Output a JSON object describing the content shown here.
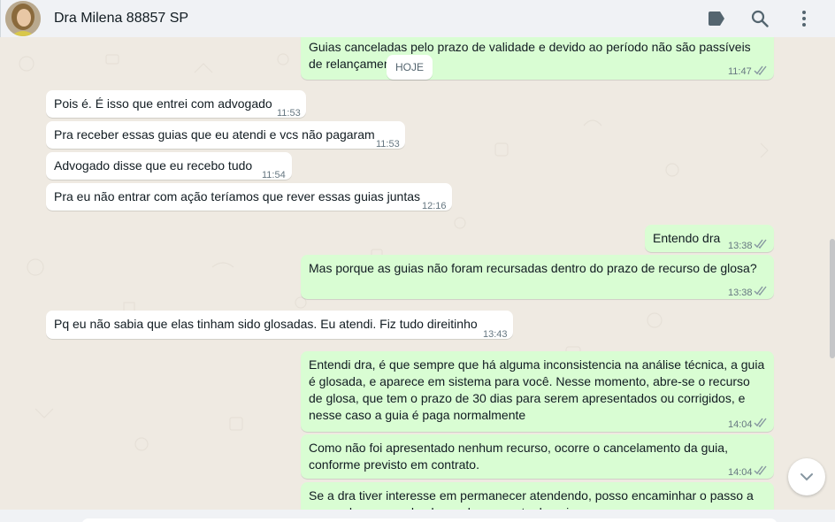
{
  "header": {
    "contact_name": "Dra Milena 88857 SP",
    "icons": [
      "label-icon",
      "search-icon",
      "menu-icon"
    ]
  },
  "chat": {
    "date_chip": "HOJE",
    "messages": [
      {
        "dir": "out",
        "text": "Guias canceladas pelo prazo de validade e devido ao período não são passíveis de relançamento.",
        "time": "11:47",
        "status": "read"
      },
      {
        "dir": "in",
        "text": "Pois é. É isso que entrei com advogado",
        "time": "11:53"
      },
      {
        "dir": "in",
        "text": "Pra receber essas guias que eu atendi e vcs não pagaram",
        "time": "11:53"
      },
      {
        "dir": "in",
        "text": "Advogado disse que eu recebo tudo",
        "time": "11:54"
      },
      {
        "dir": "in",
        "text": "Pra eu não entrar com ação teríamos que rever essas guias juntas",
        "time": "12:16"
      },
      {
        "dir": "out",
        "text": "Entendo dra",
        "time": "13:38",
        "status": "read"
      },
      {
        "dir": "out",
        "text": "Mas porque as guias não foram recursadas dentro do prazo de recurso de glosa?",
        "time": "13:38",
        "status": "read"
      },
      {
        "dir": "in",
        "text": "Pq eu não sabia que elas tinham sido glosadas. Eu atendi. Fiz tudo direitinho",
        "time": "13:43"
      },
      {
        "dir": "out",
        "text": "Entendi dra, é que sempre que há alguma inconsistencia na análise técnica, a guia é glosada, e aparece em sistema para você. Nesse momento, abre-se o recurso de glosa, que tem o prazo de 30 dias para serem apresentados ou corrigidos, e nesse caso a guia é paga normalmente",
        "time": "14:04",
        "status": "read"
      },
      {
        "dir": "out",
        "text": "Como não foi apresentado nenhum recurso, ocorre o cancelamento da guia, conforme previsto em contrato.",
        "time": "14:04",
        "status": "read"
      },
      {
        "dir": "out",
        "text": "Se a dra tiver interesse em permanecer atendendo, posso encaminhar o passo a passo de recurso de glosa e lançamento de guias.",
        "time": "",
        "status": ""
      }
    ]
  },
  "colors": {
    "outgoing_bubble": "#d9fdd3",
    "incoming_bubble": "#ffffff",
    "chat_background": "#efeae2",
    "header_background": "#f0f2f5",
    "read_ticks": "#8696a0"
  }
}
